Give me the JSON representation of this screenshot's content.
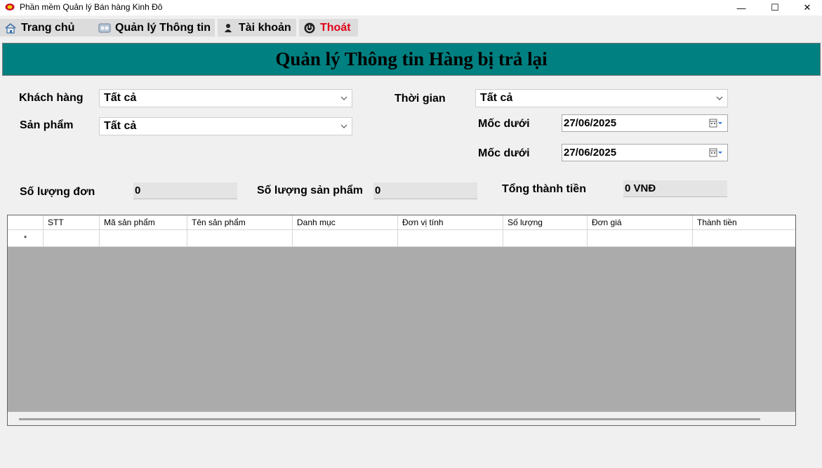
{
  "window": {
    "title": "Phần mềm Quản lý Bán hàng Kinh Đô",
    "minimize": "—",
    "maximize": "☐",
    "close": "✕"
  },
  "menu": {
    "items": [
      {
        "label": "Trang chủ",
        "icon": "home-icon"
      },
      {
        "label": "Quản lý Thông tin",
        "icon": "manage-info-icon"
      },
      {
        "label": "Tài khoản",
        "icon": "account-icon"
      },
      {
        "label": "Thoát",
        "icon": "power-icon"
      }
    ]
  },
  "header": {
    "title": "Quản lý Thông tin Hàng bị trả lại"
  },
  "filters": {
    "customer_label": "Khách hàng",
    "customer_value": "Tất cả",
    "product_label": "Sản phẩm",
    "product_value": "Tất cả",
    "time_label": "Thời gian",
    "time_value": "Tất cả",
    "lower_bound_label_1": "Mốc dưới",
    "lower_bound_value_1": "27/06/2025",
    "lower_bound_label_2": "Mốc dưới",
    "lower_bound_value_2": "27/06/2025"
  },
  "summary": {
    "order_count_label": "Số lượng đơn",
    "order_count_value": "0",
    "product_count_label": "Số lượng sản phẩm",
    "product_count_value": "0",
    "total_label": "Tổng thành tiền",
    "total_value": "0 VNĐ"
  },
  "grid": {
    "columns": [
      "",
      "STT",
      "Mã sản phẩm",
      "Tên sản phẩm",
      "Danh mục",
      "Đơn vị tính",
      "Số lượng",
      "Đơn giá",
      "Thành tiền"
    ],
    "new_row_marker": "*"
  },
  "colors": {
    "header_bg": "#008080",
    "exit_text": "#e2001a",
    "grid_bg": "#ababab"
  }
}
